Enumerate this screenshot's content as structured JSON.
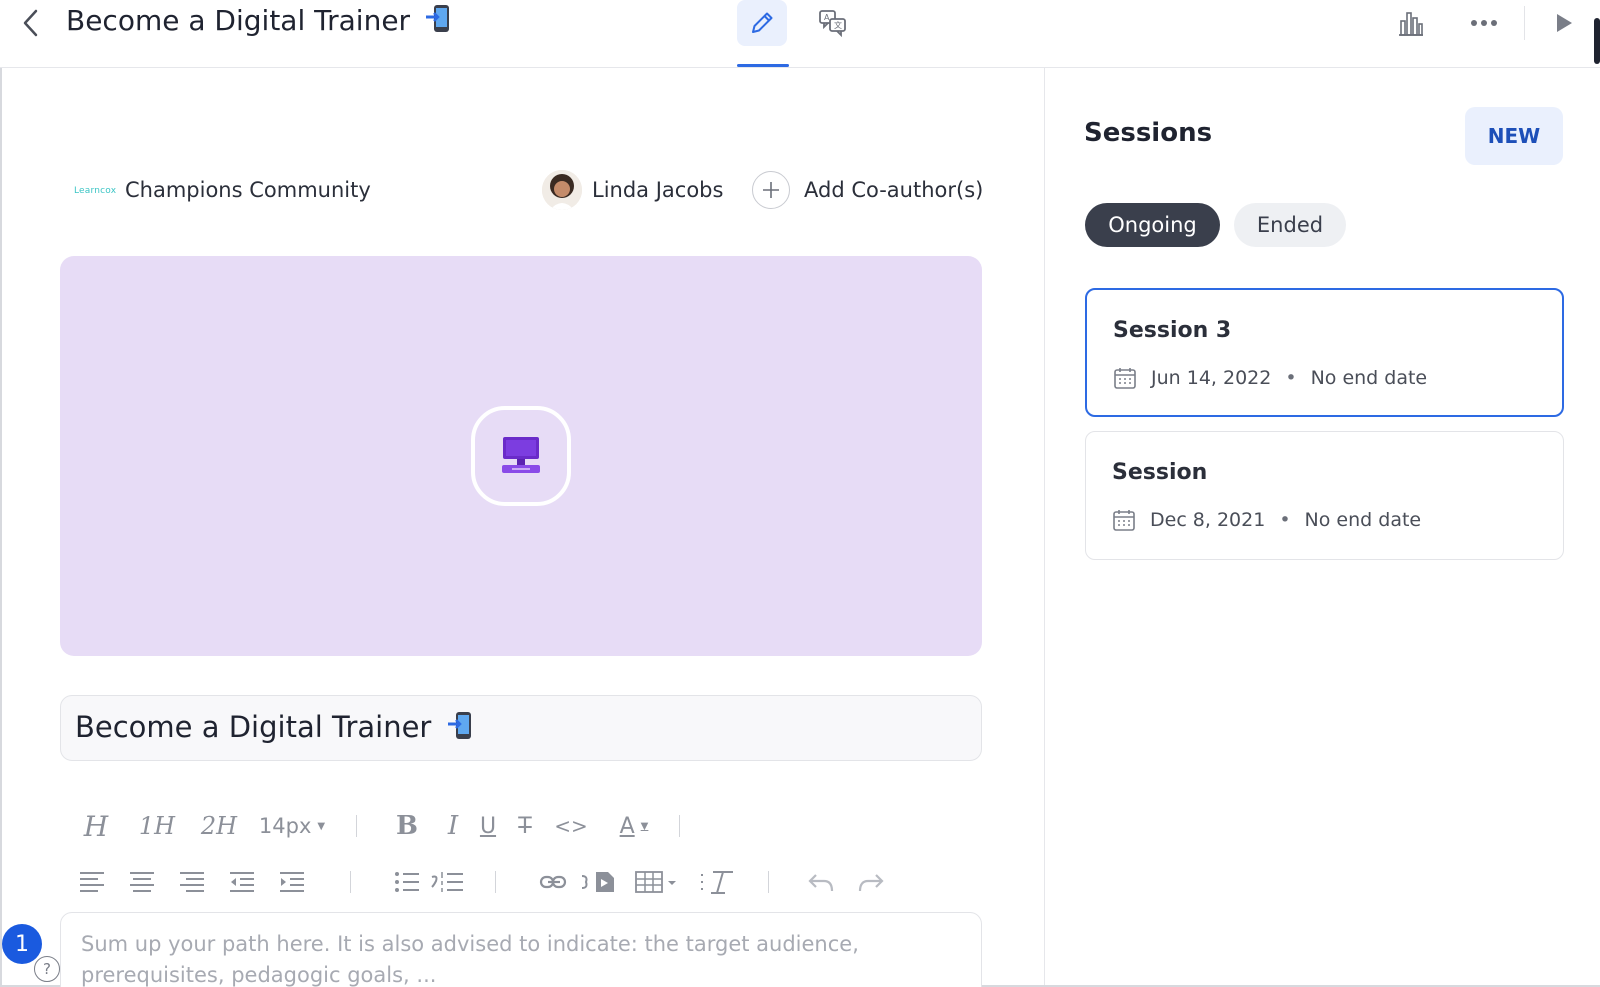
{
  "header": {
    "title": "Become a Digital Trainer",
    "tabs": [
      {
        "name": "edit",
        "icon": "pencil-icon",
        "active": true
      },
      {
        "name": "translate",
        "icon": "translate-icon",
        "active": false
      }
    ],
    "actions": [
      "bar-chart-icon",
      "more-options-icon",
      "play-icon"
    ]
  },
  "editor": {
    "community_logo_text": "Learncox",
    "community_name": "Champions Community",
    "author_name": "Linda Jacobs",
    "add_coauthor_label": "Add Co-author(s)",
    "cover_color": "#e7dcf6",
    "cover_icon": "computer-icon",
    "path_title": "Become a Digital Trainer",
    "font_size": "14px",
    "description_placeholder": "Sum up your path here. It is also advised to indicate: the target audience, prerequisites, pedagogic goals, ..."
  },
  "sessions": {
    "title": "Sessions",
    "new_label": "NEW",
    "filters": [
      {
        "label": "Ongoing",
        "active": true
      },
      {
        "label": "Ended",
        "active": false
      }
    ],
    "items": [
      {
        "name": "Session 3",
        "start": "Jun 14, 2022",
        "end": "No end date",
        "selected": true
      },
      {
        "name": "Session",
        "start": "Dec 8, 2021",
        "end": "No end date",
        "selected": false
      }
    ]
  },
  "notifications_badge": "1",
  "help_label": "?",
  "colors": {
    "accent": "#2d6ae3",
    "new_button_bg": "#eaf0fd",
    "pill_active_bg": "#3a3f4c",
    "badge": "#1a5adf"
  }
}
